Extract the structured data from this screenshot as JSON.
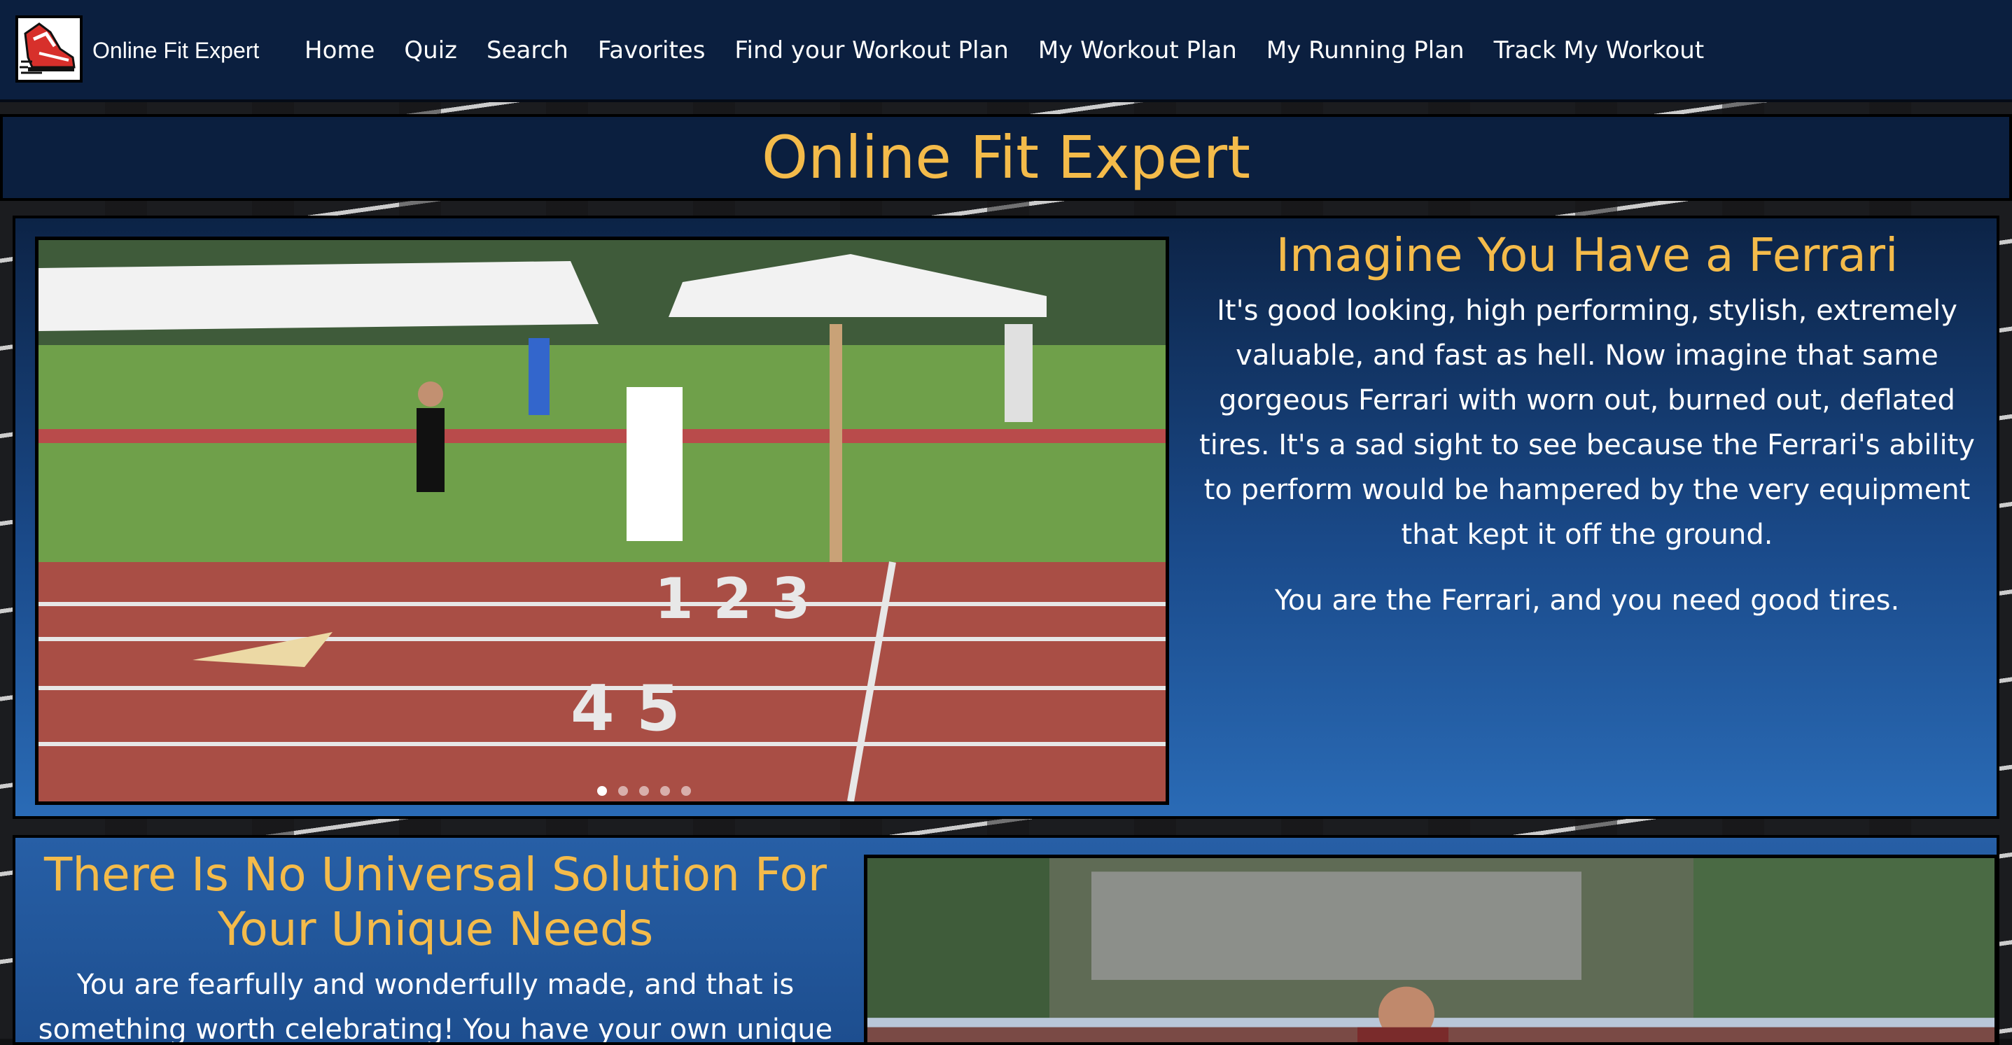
{
  "nav": {
    "brand": "Online Fit Expert",
    "logo_icon": "running-shoe-icon",
    "links": [
      "Home",
      "Quiz",
      "Search",
      "Favorites",
      "Find your Workout Plan",
      "My Workout Plan",
      "My Running Plan",
      "Track My Workout"
    ]
  },
  "page_title": "Online Fit Expert",
  "section1": {
    "heading": "Imagine You Have a Ferrari",
    "paragraph1": "It's good looking, high performing, stylish, extremely valuable, and fast as hell. Now imagine that same gorgeous Ferrari with worn out, burned out, deflated tires. It's a sad sight to see because the Ferrari's ability to perform would be hampered by the very equipment that kept it off the ground.",
    "paragraph2": "You are the Ferrari, and you need good tires.",
    "image": "sprinter-on-track-photo"
  },
  "section2": {
    "heading": "There Is No Universal Solution For Your Unique Needs",
    "paragraph1": "You are fearfully and wonderfully made, and that is something worth celebrating! You have your own unique",
    "image": "runner-race-photo"
  },
  "colors": {
    "nav_bg": "#0b1f3f",
    "accent": "#f4bb4a",
    "text": "#ffffff",
    "panel_gradient_top": "#0c2346",
    "panel_gradient_bottom": "#2a6bb6"
  }
}
